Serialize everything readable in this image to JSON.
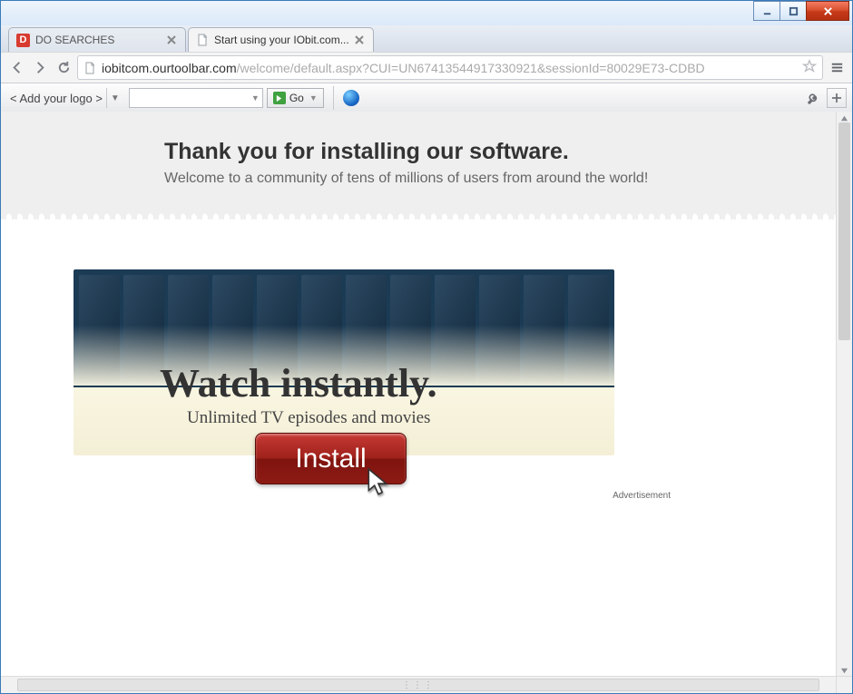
{
  "tabs": [
    {
      "title": "DO SEARCHES",
      "active": false,
      "favicon": "D"
    },
    {
      "title": "Start using your IObit.com...",
      "active": true,
      "favicon": "doc"
    }
  ],
  "address": {
    "host": "iobitcom.ourtoolbar.com",
    "path": "/welcome/default.aspx?CUI=UN67413544917330921&sessionId=80029E73-CDBD"
  },
  "toolbar": {
    "logo_slot": "< Add your logo >",
    "go_label": "Go"
  },
  "hero": {
    "title": "Thank you for installing our software.",
    "subtitle": "Welcome to a community of tens of millions of users from around the world!"
  },
  "ad": {
    "headline": "Watch instantly.",
    "subhead": "Unlimited TV episodes and movies",
    "button": "Install",
    "label": "Advertisement"
  }
}
